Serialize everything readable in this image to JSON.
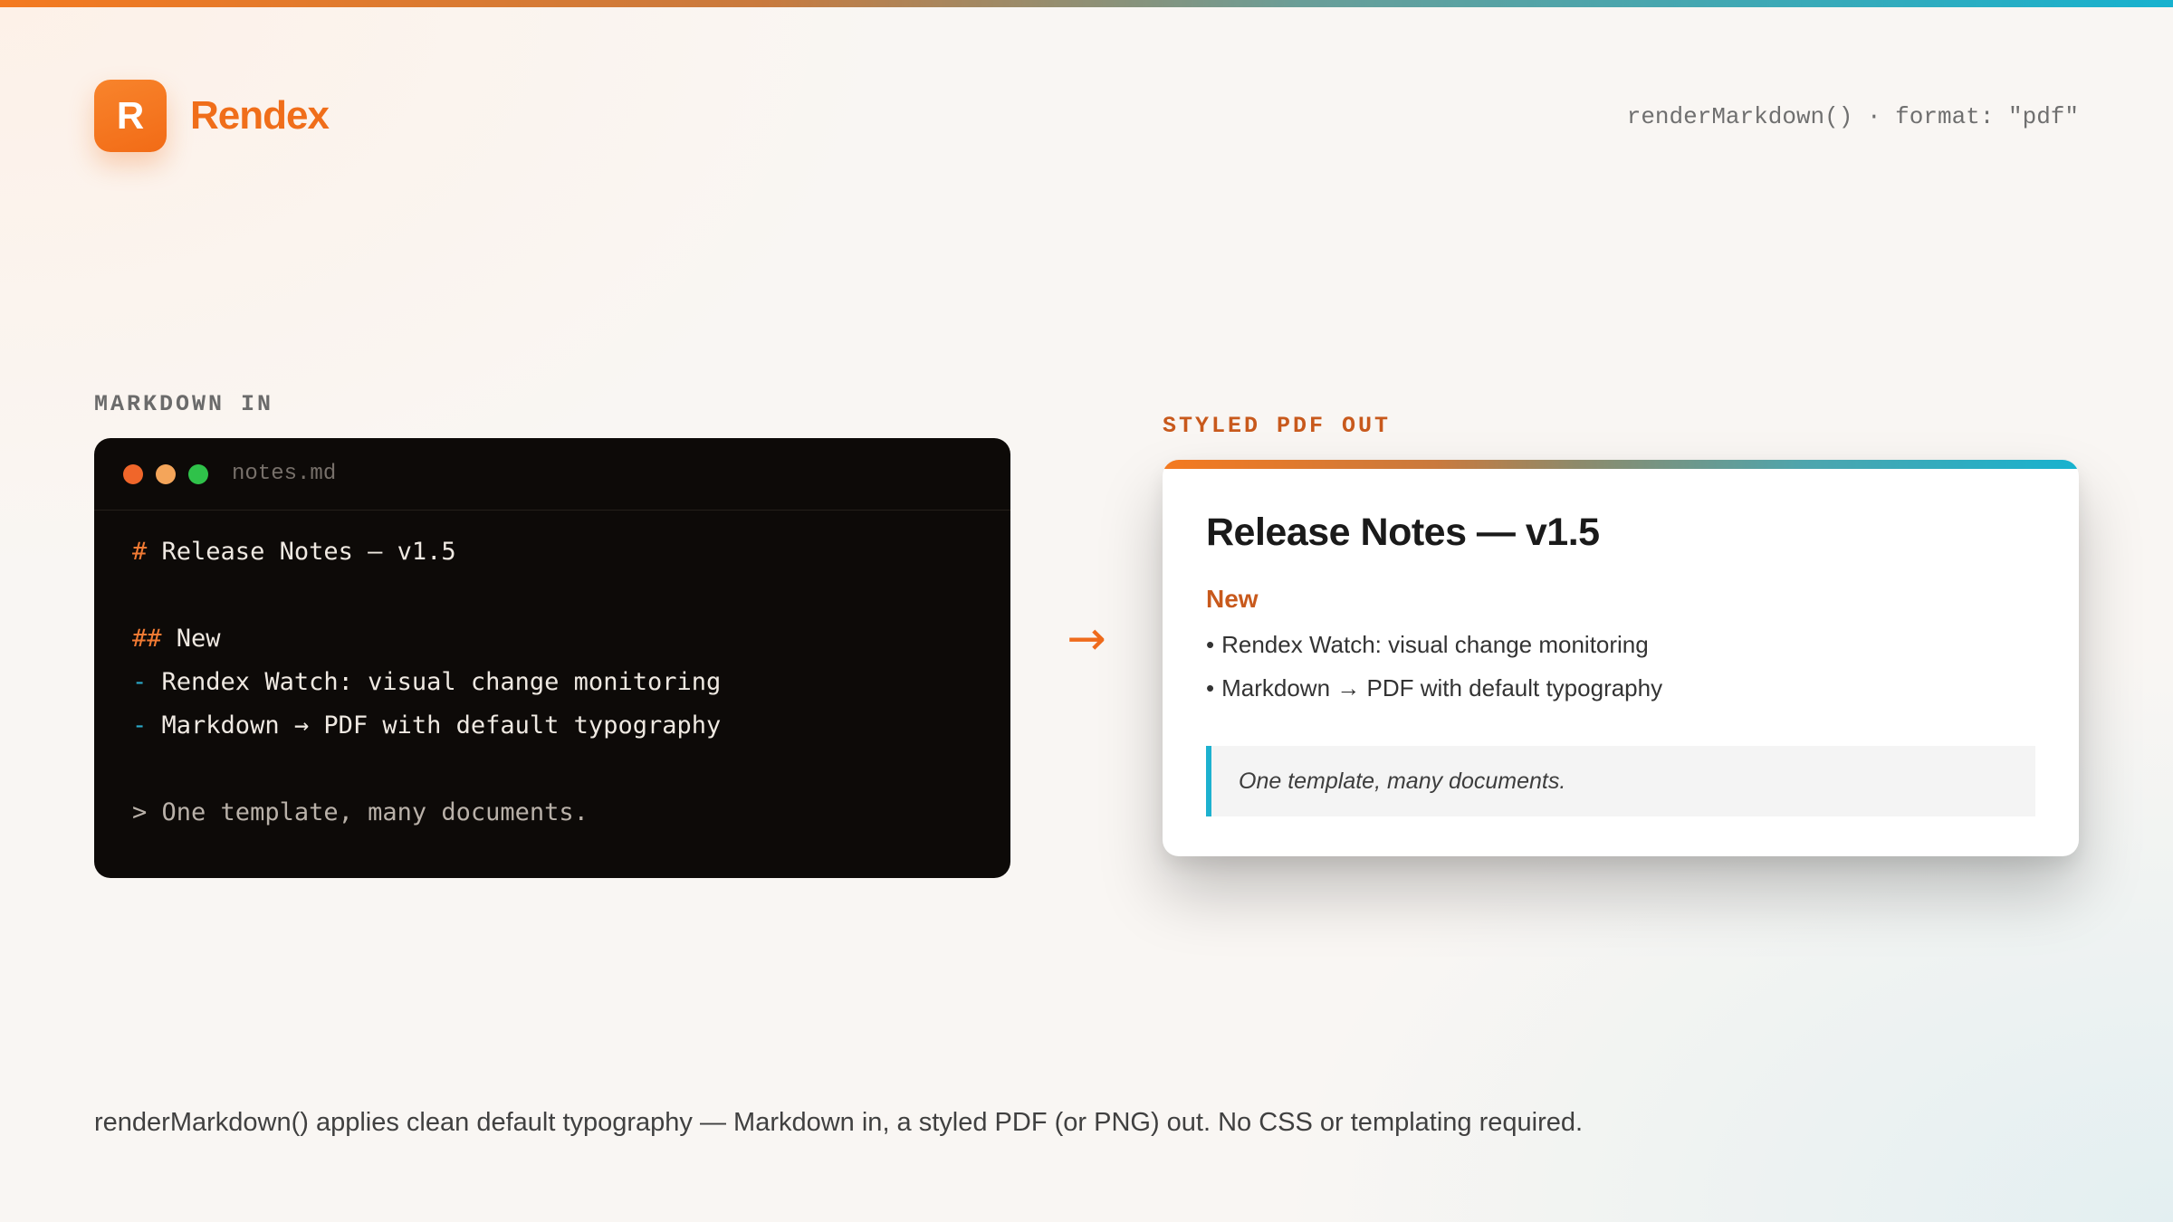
{
  "header": {
    "logo_letter": "R",
    "brand": "Rendex",
    "meta": "renderMarkdown() · format: \"pdf\""
  },
  "labels": {
    "markdown_in": "MARKDOWN IN",
    "styled_out": "STYLED PDF OUT"
  },
  "editor": {
    "file_name": "notes.md",
    "lines": {
      "h1_marker": "#",
      "h1_text": "Release Notes — v1.5",
      "h2_marker": "##",
      "h2_text": "New",
      "item_marker": "-",
      "item1": "Rendex Watch: visual change monitoring",
      "item2": "Markdown → PDF with default typography",
      "quote_marker": ">",
      "quote_text": "One template, many documents."
    }
  },
  "arrow": "→",
  "pdf": {
    "title": "Release Notes — v1.5",
    "subheading": "New",
    "bullet": "•",
    "items": [
      "Rendex Watch: visual change monitoring",
      "Markdown → PDF with default typography"
    ],
    "quote": "One template, many documents."
  },
  "caption": "renderMarkdown() applies clean default typography — Markdown in, a styled PDF (or PNG) out. No CSS or templating required.",
  "colors": {
    "brand_orange": "#f06e1a",
    "accent_teal": "#17b2cf",
    "editor_bg": "#0d0a08"
  }
}
